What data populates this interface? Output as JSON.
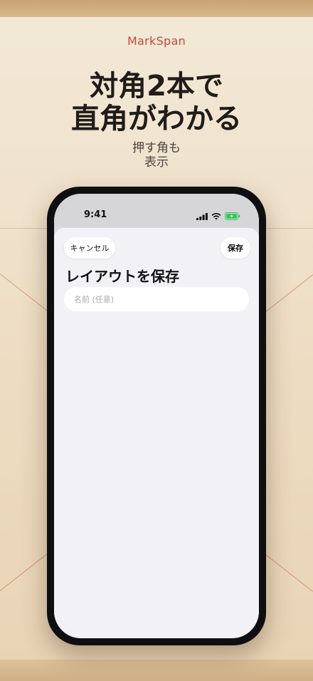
{
  "brand": "MarkSpan",
  "headline": {
    "line1": "対角2本で",
    "line2": "直角がわかる"
  },
  "subline": {
    "line1": "押す角も",
    "line2": "表示"
  },
  "status_bar": {
    "time": "9:41"
  },
  "sheet": {
    "cancel_label": "キャンセル",
    "save_label": "保存",
    "title": "レイアウトを保存",
    "name_field": {
      "value": "",
      "placeholder": "名前 (任意)"
    }
  },
  "colors": {
    "brand": "#c44a3a",
    "headline": "#1f1c19",
    "sheet_background": "#f2f2f6",
    "battery_green": "#34c759"
  }
}
